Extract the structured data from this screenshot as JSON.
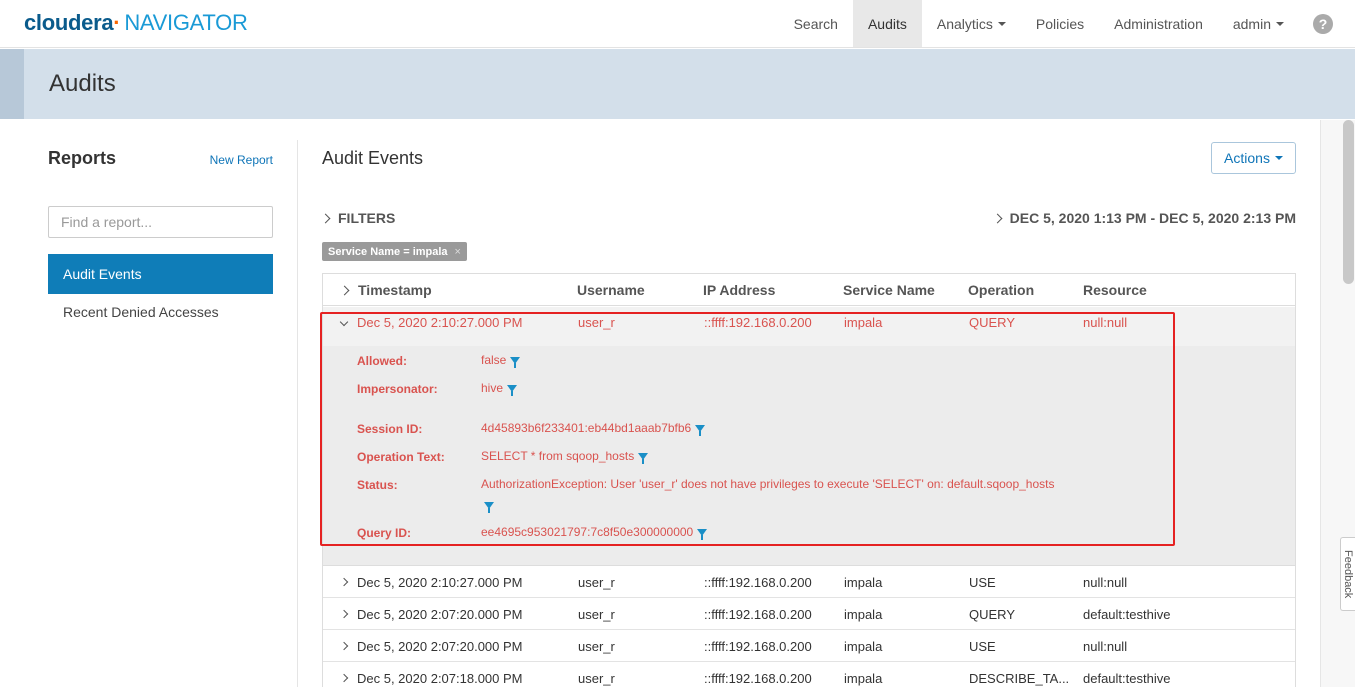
{
  "brand": {
    "name": "cloudera",
    "mark": "·",
    "product": "NAVIGATOR"
  },
  "nav": {
    "items": [
      "Search",
      "Audits",
      "Analytics",
      "Policies",
      "Administration",
      "admin"
    ],
    "active": "Audits",
    "help": "?"
  },
  "header": {
    "title": "Audits"
  },
  "reports": {
    "title": "Reports",
    "new_report": "New Report",
    "search_placeholder": "Find a report...",
    "items": [
      "Audit Events",
      "Recent Denied Accesses"
    ],
    "active": "Audit Events"
  },
  "main": {
    "title": "Audit Events",
    "actions_label": "Actions",
    "filters_label": "FILTERS",
    "date_range": "DEC 5, 2020 1:13 PM - DEC 5, 2020 2:13 PM",
    "filter_chip": "Service Name = impala",
    "chip_close": "×"
  },
  "table": {
    "columns": [
      "Timestamp",
      "Username",
      "IP Address",
      "Service Name",
      "Operation",
      "Resource"
    ],
    "expanded_row": {
      "timestamp": "Dec 5, 2020 2:10:27.000 PM",
      "username": "user_r",
      "ip": "::ffff:192.168.0.200",
      "service": "impala",
      "operation": "QUERY",
      "resource": "null:null"
    },
    "details": {
      "allowed_label": "Allowed:",
      "allowed_value": "false",
      "impersonator_label": "Impersonator:",
      "impersonator_value": "hive",
      "session_label": "Session ID:",
      "session_value": "4d45893b6f233401:eb44bd1aaab7bfb6",
      "optext_label": "Operation Text:",
      "optext_value": "SELECT * from sqoop_hosts",
      "status_label": "Status:",
      "status_value": "AuthorizationException: User 'user_r' does not have privileges to execute 'SELECT' on: default.sqoop_hosts",
      "queryid_label": "Query ID:",
      "queryid_value": "ee4695c953021797:7c8f50e300000000"
    },
    "rows": [
      {
        "timestamp": "Dec 5, 2020 2:10:27.000 PM",
        "username": "user_r",
        "ip": "::ffff:192.168.0.200",
        "service": "impala",
        "operation": "USE",
        "resource": "null:null"
      },
      {
        "timestamp": "Dec 5, 2020 2:07:20.000 PM",
        "username": "user_r",
        "ip": "::ffff:192.168.0.200",
        "service": "impala",
        "operation": "QUERY",
        "resource": "default:testhive"
      },
      {
        "timestamp": "Dec 5, 2020 2:07:20.000 PM",
        "username": "user_r",
        "ip": "::ffff:192.168.0.200",
        "service": "impala",
        "operation": "USE",
        "resource": "null:null"
      },
      {
        "timestamp": "Dec 5, 2020 2:07:18.000 PM",
        "username": "user_r",
        "ip": "::ffff:192.168.0.200",
        "service": "impala",
        "operation": "DESCRIBE_TA...",
        "resource": "default:testhive"
      }
    ]
  },
  "feedback": "Feedback",
  "colors": {
    "brand_dark": "#0a5b8c",
    "brand_light": "#1a9ad6",
    "accent": "#0f7db8",
    "error": "#d9534f",
    "highlight_box": "#e52222"
  }
}
